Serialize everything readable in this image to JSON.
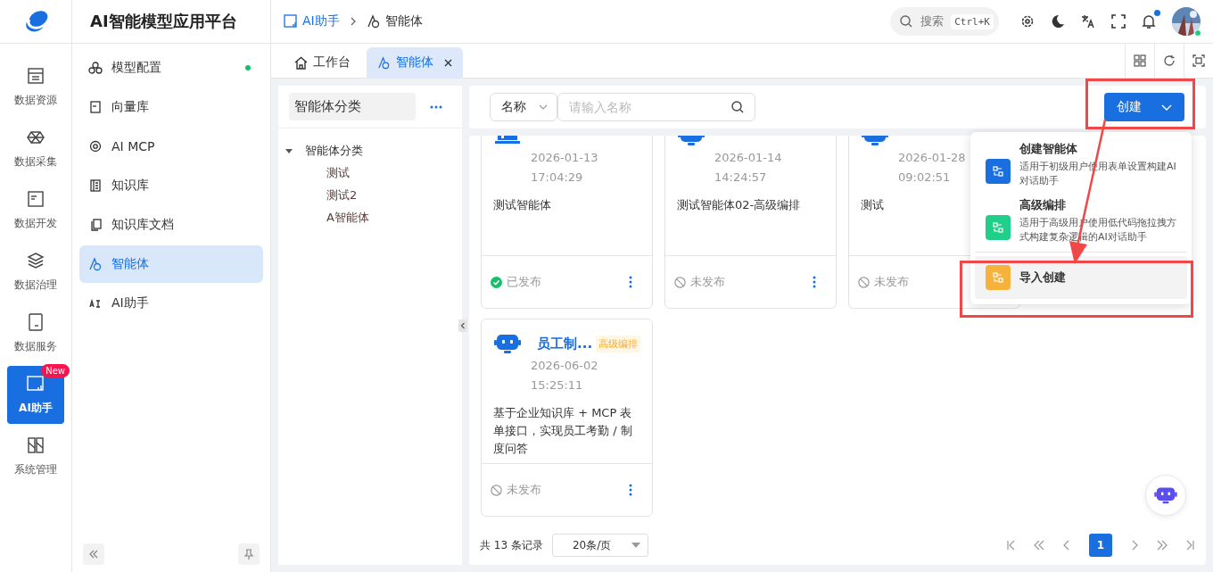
{
  "app": {
    "title": "AI智能模型应用平台"
  },
  "breadcrumb": [
    {
      "label": "AI助手",
      "current": false
    },
    {
      "label": "智能体",
      "current": true
    }
  ],
  "search": {
    "placeholder": "搜索",
    "shortcut": "Ctrl+K"
  },
  "notifications": {
    "unread": true
  },
  "rail": [
    {
      "label": "数据资源",
      "selected": false
    },
    {
      "label": "数据采集",
      "selected": false
    },
    {
      "label": "数据开发",
      "selected": false
    },
    {
      "label": "数据治理",
      "selected": false
    },
    {
      "label": "数据服务",
      "selected": false
    },
    {
      "label": "AI助手",
      "selected": true,
      "badge": "New"
    },
    {
      "label": "系统管理",
      "selected": false
    }
  ],
  "sidebar": {
    "items": [
      {
        "label": "模型配置",
        "selected": false,
        "dot": true
      },
      {
        "label": "向量库",
        "selected": false,
        "dot": false
      },
      {
        "label": "AI MCP",
        "selected": false,
        "dot": false
      },
      {
        "label": "知识库",
        "selected": false,
        "dot": false
      },
      {
        "label": "知识库文档",
        "selected": false,
        "dot": false
      },
      {
        "label": "智能体",
        "selected": true,
        "dot": false
      },
      {
        "label": "AI助手",
        "selected": false,
        "dot": false
      }
    ]
  },
  "tabs": [
    {
      "label": "工作台",
      "selected": false,
      "closable": false
    },
    {
      "label": "智能体",
      "selected": true,
      "closable": true
    }
  ],
  "categories": {
    "title": "智能体分类",
    "tree": [
      {
        "label": "智能体分类",
        "expanded": true,
        "children": [
          {
            "label": "测试"
          },
          {
            "label": "测试2"
          },
          {
            "label": "A智能体"
          }
        ]
      }
    ]
  },
  "filter": {
    "field": "名称",
    "placeholder": "请输入名称"
  },
  "create_button": {
    "label": "创建"
  },
  "create_menu": [
    {
      "title": "创建智能体",
      "description": "适用于初级用户使用表单设置构建AI对话助手",
      "color": "#1a6fe0",
      "selected": false
    },
    {
      "title": "高级编排",
      "description": "适用于高级用户使用低代码拖拉拽方式构建复杂逻辑的AI对话助手",
      "color": "#1fcf8a",
      "selected": false
    },
    {
      "title": "导入创建",
      "color": "#f7b23b",
      "selected": true
    }
  ],
  "card_rows": [
    {
      "cards": [
        {
          "date": "2026-01-13",
          "time": "17:04:29",
          "description": "测试智能体",
          "published": true,
          "status": "已发布"
        },
        {
          "date": "2026-01-14",
          "time": "14:24:57",
          "description": "测试智能体02-高级编排",
          "published": false,
          "status": "未发布"
        },
        {
          "date": "2026-01-28",
          "time": "09:02:51",
          "description": "测试",
          "published": false,
          "status": "未发布"
        }
      ]
    },
    {
      "cards": [
        {
          "title": "员工制...",
          "tag": "高级编排",
          "date": "2026-06-02",
          "time": "15:25:11",
          "description": "基于企业知识库 + MCP 表单接口，实现员工考勤 / 制度问答",
          "published": false,
          "status": "未发布"
        }
      ]
    }
  ],
  "pagination": {
    "total": "共 13 条记录",
    "page_size": "20条/页",
    "pages": [
      {
        "label": "1",
        "selected": true
      }
    ]
  }
}
